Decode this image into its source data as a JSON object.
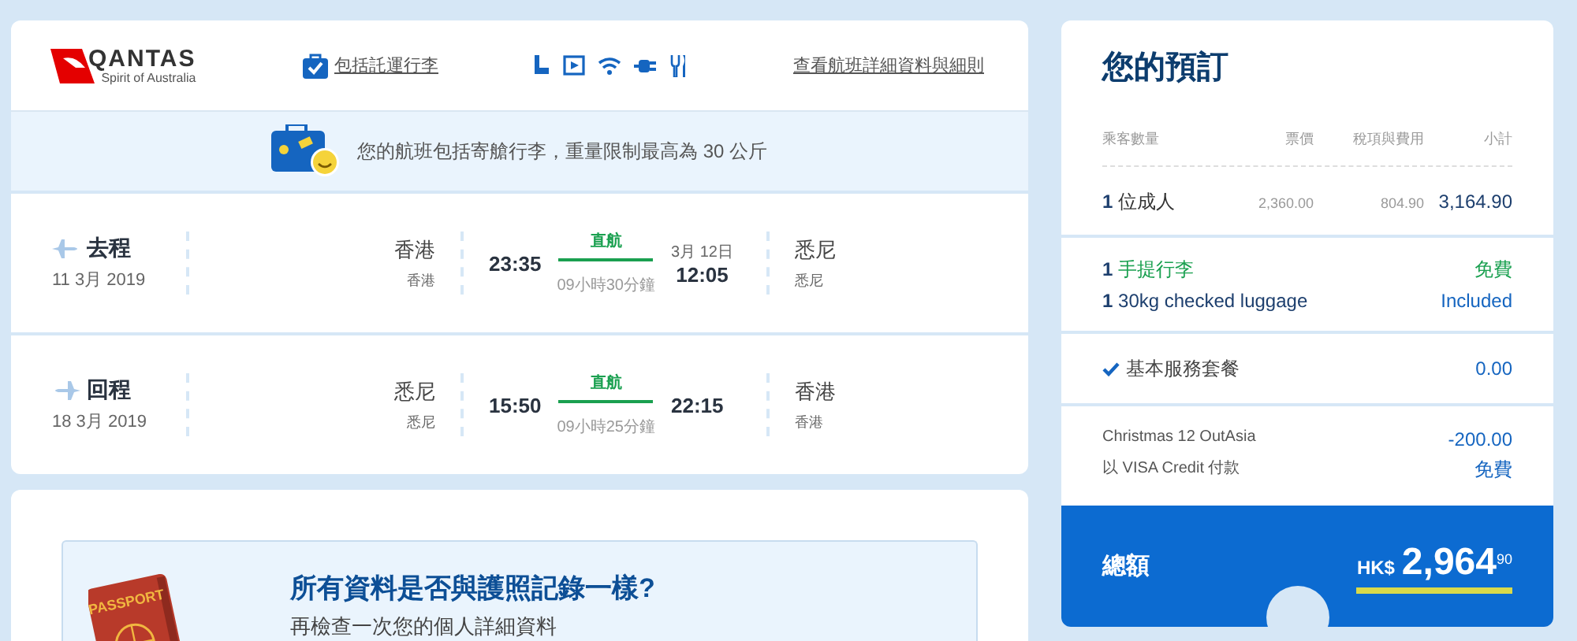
{
  "header": {
    "logo": {
      "name": "QANTAS",
      "tagline": "Spirit of Australia"
    },
    "baggage_link": "包括託運行李",
    "details_link": "查看航班詳細資料與細則"
  },
  "banner": "您的航班包括寄艙行李，重量限制最高為 30 公斤",
  "flights": [
    {
      "label": "去程",
      "date": "11 3月 2019",
      "from_city": "香港",
      "from_airport": "香港",
      "depart": "23:35",
      "type": "直航",
      "arrive_date": "3月 12日",
      "arrive": "12:05",
      "duration": "09小時30分鐘",
      "to_city": "悉尼",
      "to_airport": "悉尼",
      "kind": "outbound"
    },
    {
      "label": "回程",
      "date": "18 3月 2019",
      "from_city": "悉尼",
      "from_airport": "悉尼",
      "depart": "15:50",
      "type": "直航",
      "arrive": "22:15",
      "duration": "09小時25分鐘",
      "to_city": "香港",
      "to_airport": "香港",
      "kind": "inbound"
    }
  ],
  "passport_check": {
    "badge": "PASSPORT",
    "title": "所有資料是否與護照記錄一樣?",
    "subtitle": "再檢查一次您的個人詳細資料"
  },
  "booking": {
    "title": "您的預訂",
    "columns": [
      "乘客數量",
      "票價",
      "稅項與費用",
      "小計"
    ],
    "passenger": {
      "count": "1",
      "label": "位成人",
      "fare": "2,360.00",
      "taxes": "804.90",
      "subtotal": "3,164.90"
    },
    "extras": [
      {
        "count": "1",
        "label": "手提行李",
        "value": "免費",
        "color": "#1aa050"
      },
      {
        "count": "1",
        "label": "30kg checked luggage",
        "value": "Included",
        "color": "#1d3f6e"
      }
    ],
    "service": {
      "checked": true,
      "label": "基本服務套餐",
      "value": "0.00"
    },
    "discounts": [
      {
        "label": "Christmas 12 OutAsia",
        "value": "-200.00"
      },
      {
        "label": "以 VISA Credit 付款",
        "value": "免費"
      }
    ],
    "total": {
      "label": "總額",
      "currency": "HK$",
      "amount": "2,964",
      "decimals": "90"
    }
  }
}
